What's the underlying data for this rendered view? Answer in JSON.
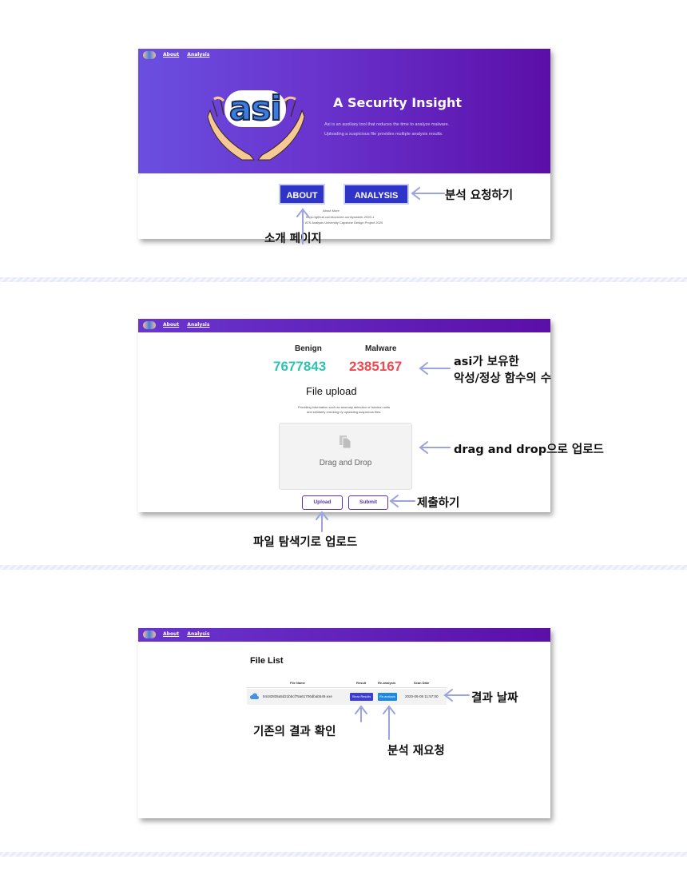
{
  "nav": {
    "about": "About",
    "analysis": "Analysis"
  },
  "hero": {
    "logo_text": "asi",
    "title": "A Security Insight",
    "desc1": "Asi is an auxiliary tool that reduces the time to analyze malware.",
    "desc2": "Uploading a suspicious file provides multiple analysis results.",
    "about_button": "ABOUT",
    "analysis_button": "ANALYSIS",
    "about_more": "About More",
    "footer1": "https://github.com/kovicree-ounhyoweeir-2020-1",
    "footer2": "© ATS Analysis University Capstone Design Project 2020"
  },
  "upload": {
    "benign_label": "Benign",
    "malware_label": "Malware",
    "benign_count": "7677843",
    "malware_count": "2385167",
    "title": "File upload",
    "desc1": "Providing information such as anomaly detection of function units",
    "desc2": "and similarity checking by uploading suspicious files.",
    "drop_label": "Drag and Drop",
    "upload_button": "Upload",
    "submit_button": "Submit"
  },
  "filelist": {
    "title": "File List",
    "columns": [
      "File Name",
      "Result",
      "Re-analysis",
      "Scan Date"
    ],
    "rows": [
      {
        "file_name": "84c82835a5d21bbcf75a61706dbab549.exe",
        "result": "Show Results",
        "reanalysis": "Re-analysis",
        "scan_date": "2020-06-08 11:57:00"
      }
    ]
  },
  "annotations": {
    "analysis_request": "분석 요청하기",
    "intro_page": "소개 페이지",
    "asi_counts_1": "asi가 보유한",
    "asi_counts_2": "악성/정상 함수의 수",
    "drag_drop_upload": "drag and drop으로 업로드",
    "submit": "제출하기",
    "file_explorer_upload": "파일 탐색기로 업로드",
    "result_date": "결과 날짜",
    "existing_result": "기존의 결과 확인",
    "reanalysis_request": "분석 재요청"
  },
  "colors": {
    "header_purple": "#5b0fa8",
    "button_blue": "#2f34c9",
    "benign_teal": "#2ec4b0",
    "malware_red": "#f0494f",
    "arrow": "#9aa4e0"
  }
}
